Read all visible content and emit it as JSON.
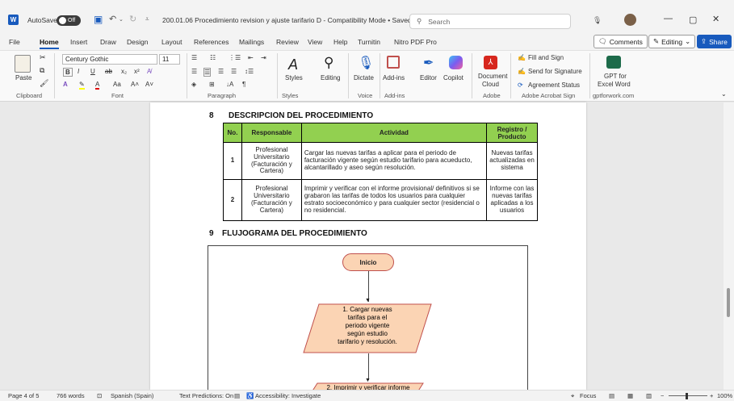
{
  "titlebar": {
    "autosave_label": "AutoSave",
    "autosave_state": "Off",
    "doc_title": "200.01.06 Procedimiento revision y ajuste tarifario D  -  Compatibility Mode  •  Saved ∨",
    "search_placeholder": "Search"
  },
  "menu": {
    "items": [
      "File",
      "Home",
      "Insert",
      "Draw",
      "Design",
      "Layout",
      "References",
      "Mailings",
      "Review",
      "View",
      "Help",
      "Turnitin",
      "Nitro PDF Pro"
    ],
    "active": "Home",
    "comments_label": "Comments",
    "editing_label": "Editing",
    "share_label": "Share"
  },
  "ribbon": {
    "paste_label": "Paste",
    "font_name": "Century Gothic",
    "font_size": "11",
    "styles_label": "Styles",
    "editing_label": "Editing",
    "dictate_label": "Dictate",
    "addins_label": "Add-ins",
    "editor_label": "Editor",
    "copilot_label": "Copilot",
    "document_cloud_label_1": "Document",
    "document_cloud_label_2": "Cloud",
    "fill_sign_label": "Fill and Sign",
    "send_signature_label": "Send for Signature",
    "agreement_status_label": "Agreement Status",
    "gpt_label_1": "GPT for",
    "gpt_label_2": "Excel Word",
    "groups": {
      "clipboard": "Clipboard",
      "font": "Font",
      "paragraph": "Paragraph",
      "styles": "Styles",
      "voice": "Voice",
      "addins": "Add-ins",
      "adobe": "Adobe",
      "adobe_sign": "Adobe Acrobat Sign",
      "gptforwork": "gptforwork.com"
    }
  },
  "document": {
    "section8_number": "8",
    "section8_title": "DESCRIPCION DEL PROCEDIMIENTO",
    "table_headers": [
      "No.",
      "Responsable",
      "Actividad",
      "Registro / Producto"
    ],
    "rows": [
      {
        "no": "1",
        "responsable": "Profesional Universitario (Facturación y Cartera)",
        "actividad": "Cargar las nuevas tarifas a aplicar para el periodo de facturación vigente según estudio tarifario para acueducto, alcantarillado y aseo según resolución.",
        "registro": "Nuevas tarifas actualizadas en sistema"
      },
      {
        "no": "2",
        "responsable": "Profesional Universitario (Facturación y Cartera)",
        "actividad": "Imprimir y verificar con el informe provisional/ definitivos si se grabaron las tarifas de todos los usuarios para cualquier estrato socioeconómico y para cualquier sector (residencial o no residencial.",
        "registro": "Informe con las nuevas tarifas aplicadas a los usuarios"
      }
    ],
    "section9_number": "9",
    "section9_title": "FLUJOGRAMA DEL PROCEDIMIENTO",
    "flow_start": "Inicio",
    "flow_step1_lines": [
      "1. Cargar nuevas",
      "tarifas para el",
      "periodo vigente",
      "según estudio",
      "tarifario y resolución."
    ],
    "flow_step2": "2. Imprimir y verificar informe"
  },
  "statusbar": {
    "page": "Page 4 of 5",
    "words": "766 words",
    "language": "Spanish (Spain)",
    "text_predictions": "Text Predictions: On",
    "accessibility": "Accessibility: Investigate",
    "focus": "Focus",
    "zoom": "100%"
  },
  "colors": {
    "header_green": "#92d050",
    "flow_fill": "#fbd4b4",
    "flow_stroke": "#c0504d",
    "accent_blue": "#185abd"
  }
}
